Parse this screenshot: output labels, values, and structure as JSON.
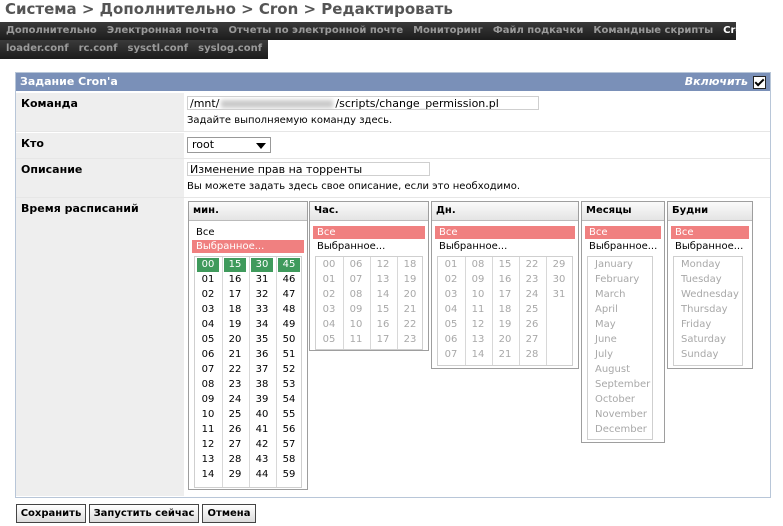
{
  "breadcrumb": "Система > Дополнительно > Cron > Редактировать",
  "nav_row1": [
    "Дополнительно",
    "Электронная почта",
    "Отчеты по электронной почте",
    "Мониторинг",
    "Файл подкачки",
    "Командные скрипты",
    "Cron"
  ],
  "nav_row2": [
    "loader.conf",
    "rc.conf",
    "sysctl.conf",
    "syslog.conf"
  ],
  "nav_active": "Cron",
  "panel": {
    "title": "Задание Cron'a",
    "enable_label": "Включить",
    "enabled": true
  },
  "command": {
    "label": "Команда",
    "value_prefix": "/mnt/",
    "value_suffix": "/scripts/change_permission.pl",
    "hint": "Задайте выполняемую команду здесь."
  },
  "who": {
    "label": "Кто",
    "value": "root"
  },
  "description": {
    "label": "Описание",
    "value": "Изменение прав на торренты",
    "hint": "Вы можете задать здесь свое описание, если это необходимо."
  },
  "schedule": {
    "label": "Время расписаний",
    "minutes": {
      "title": "мин.",
      "opt_all": "Все",
      "opt_selected": "Выбранное...",
      "selected_option": "selected",
      "cols": [
        [
          "00",
          "01",
          "02",
          "03",
          "04",
          "05",
          "06",
          "07",
          "08",
          "09",
          "10",
          "11",
          "12",
          "13",
          "14"
        ],
        [
          "15",
          "16",
          "17",
          "18",
          "19",
          "20",
          "21",
          "22",
          "23",
          "24",
          "25",
          "26",
          "27",
          "28",
          "29"
        ],
        [
          "30",
          "31",
          "32",
          "33",
          "34",
          "35",
          "36",
          "37",
          "38",
          "39",
          "40",
          "41",
          "42",
          "43",
          "44"
        ],
        [
          "45",
          "46",
          "47",
          "48",
          "49",
          "50",
          "51",
          "52",
          "53",
          "54",
          "55",
          "56",
          "57",
          "58",
          "59"
        ]
      ],
      "checked": [
        "00",
        "15",
        "30",
        "45"
      ]
    },
    "hours": {
      "title": "Час.",
      "opt_all": "Все",
      "opt_selected": "Выбранное...",
      "selected_option": "all",
      "cols": [
        [
          "00",
          "01",
          "02",
          "03",
          "04",
          "05"
        ],
        [
          "06",
          "07",
          "08",
          "09",
          "10",
          "11"
        ],
        [
          "12",
          "13",
          "14",
          "15",
          "16",
          "17"
        ],
        [
          "18",
          "19",
          "20",
          "21",
          "22",
          "23"
        ]
      ]
    },
    "days": {
      "title": "Дн.",
      "opt_all": "Все",
      "opt_selected": "Выбранное...",
      "selected_option": "all",
      "cols": [
        [
          "01",
          "02",
          "03",
          "04",
          "05",
          "06",
          "07"
        ],
        [
          "08",
          "09",
          "10",
          "11",
          "12",
          "13",
          "14"
        ],
        [
          "15",
          "16",
          "17",
          "18",
          "19",
          "20",
          "21"
        ],
        [
          "22",
          "23",
          "24",
          "25",
          "26",
          "27",
          "28"
        ],
        [
          "29",
          "30",
          "31"
        ]
      ]
    },
    "months": {
      "title": "Месяцы",
      "opt_all": "Все",
      "opt_selected": "Выбранное...",
      "selected_option": "all",
      "items": [
        "January",
        "February",
        "March",
        "April",
        "May",
        "June",
        "July",
        "August",
        "September",
        "October",
        "November",
        "December"
      ]
    },
    "weekdays": {
      "title": "Будни",
      "opt_all": "Все",
      "opt_selected": "Выбранное...",
      "selected_option": "all",
      "items": [
        "Monday",
        "Tuesday",
        "Wednesday",
        "Thursday",
        "Friday",
        "Saturday",
        "Sunday"
      ]
    }
  },
  "buttons": {
    "save": "Сохранить",
    "run_now": "Запустить сейчас",
    "cancel": "Отмена"
  },
  "colors": {
    "nav_bg": "#2a2a2a",
    "panel_head": "#7a90b8",
    "selected_option": "#f08080",
    "checked_cell": "#3f9a5c"
  }
}
